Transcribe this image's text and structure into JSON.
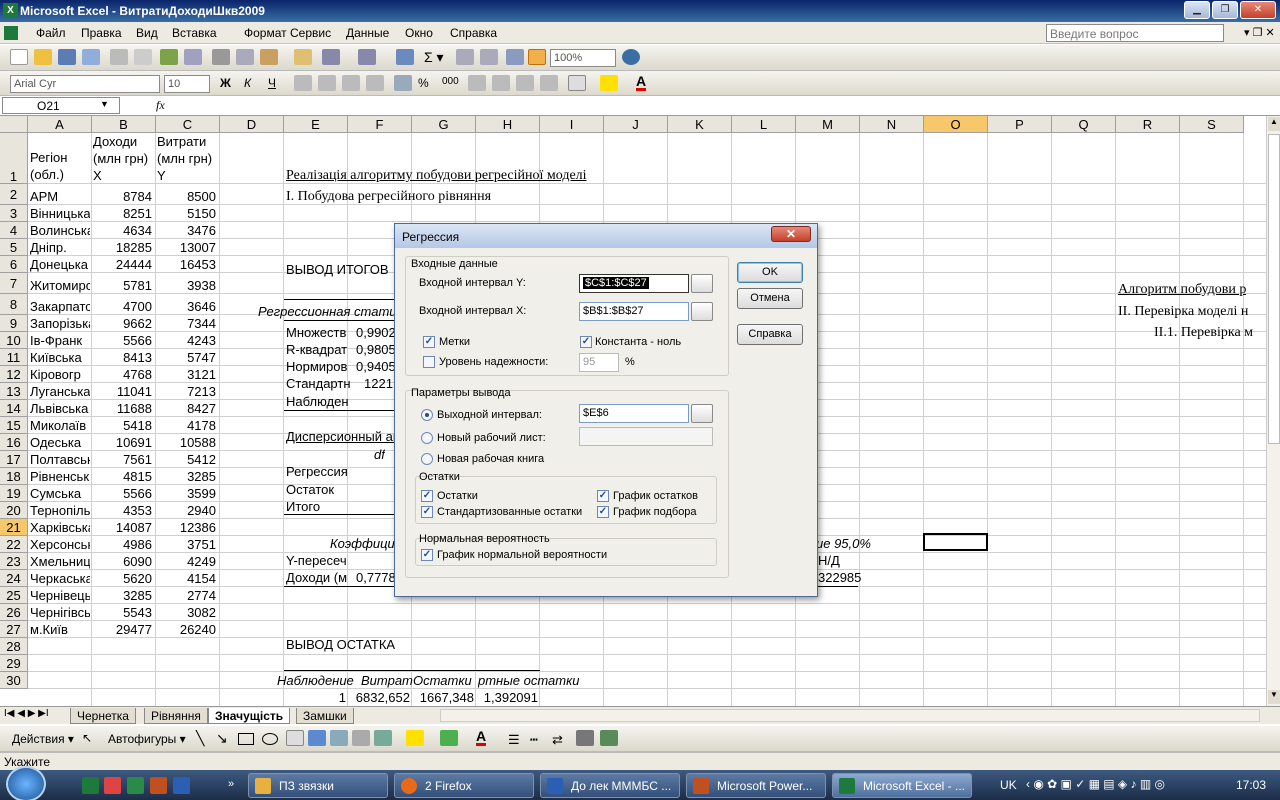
{
  "window": {
    "title": "Microsoft Excel - ВитратиДоходиШкв2009",
    "ask_placeholder": "Введите вопрос"
  },
  "menu": [
    "Файл",
    "Правка",
    "Вид",
    "Вставка",
    "Формат",
    "Сервис",
    "Данные",
    "Окно",
    "Справка"
  ],
  "toolbar": {
    "zoom": "100%",
    "font": "Arial Cyr",
    "size": "10"
  },
  "formula": {
    "namebox": "O21",
    "fx": "fx"
  },
  "columns": [
    "A",
    "B",
    "C",
    "D",
    "E",
    "F",
    "G",
    "H",
    "I",
    "J",
    "K",
    "L",
    "M",
    "N",
    "O",
    "P",
    "Q",
    "R",
    "S"
  ],
  "rows": [
    "1",
    "2",
    "3",
    "4",
    "5",
    "6",
    "7",
    "8",
    "9",
    "10",
    "11",
    "12",
    "13",
    "14",
    "15",
    "16",
    "17",
    "18",
    "19",
    "20",
    "21",
    "22",
    "23",
    "24",
    "25",
    "26",
    "27",
    "28",
    "29",
    "30"
  ],
  "header": {
    "a": [
      "Регіон",
      "(обл.)"
    ],
    "b": [
      "Доходи",
      "(млн грн)",
      "X"
    ],
    "c": [
      "Витрати",
      "(млн грн)",
      "Y"
    ]
  },
  "data": [
    [
      "АРМ",
      "8784",
      "8500"
    ],
    [
      "Вінницька",
      "8251",
      "5150"
    ],
    [
      "Волинська",
      "4634",
      "3476"
    ],
    [
      "Дніпр.",
      "18285",
      "13007"
    ],
    [
      "Донецька",
      "24444",
      "16453"
    ],
    [
      "Житомирс",
      "5781",
      "3938"
    ],
    [
      "Закарпатс",
      "4700",
      "3646"
    ],
    [
      "Запорізька",
      "9662",
      "7344"
    ],
    [
      "Ів-Франк",
      "5566",
      "4243"
    ],
    [
      "Київська",
      "8413",
      "5747"
    ],
    [
      "Кіровогр",
      "4768",
      "3121"
    ],
    [
      "Луганська",
      "11041",
      "7213"
    ],
    [
      "Львівська",
      "11688",
      "8427"
    ],
    [
      "Миколаїв",
      "5418",
      "4178"
    ],
    [
      "Одеська",
      "10691",
      "10588"
    ],
    [
      "Полтавськ",
      "7561",
      "5412"
    ],
    [
      "Рівненськ",
      "4815",
      "3285"
    ],
    [
      "Сумська",
      "5566",
      "3599"
    ],
    [
      "Тернопіль",
      "4353",
      "2940"
    ],
    [
      "Харківська",
      "14087",
      "12386"
    ],
    [
      "Херсонськ",
      "4986",
      "3751"
    ],
    [
      "Хмельниц",
      "6090",
      "4249"
    ],
    [
      "Черкаська",
      "5620",
      "4154"
    ],
    [
      "Чернівець",
      "3285",
      "2774"
    ],
    [
      "Чернігівсь",
      "5543",
      "3082"
    ],
    [
      "м.Київ",
      "29477",
      "26240"
    ]
  ],
  "sheet_text": {
    "heading1": "Реалізація алгоритму побудови регресійної моделі",
    "heading2": "І. Побудова регресійного рівняння",
    "vyvod": "ВЫВОД ИТОГОВ",
    "regstat": "Регрессионная стати",
    "mnozh": "Множеств",
    "mnozh_v": "0,9902",
    "rkv": "R-квадрат",
    "rkv_v": "0,9805",
    "norm": "Нормиров",
    "norm_v": "0,9405",
    "stand": "Стандартн",
    "stand_v": "1221,",
    "nabl": "Наблюден",
    "disp": "Дисперсионный ан",
    "df": "df",
    "regr": "Регрессия",
    "ost": "Остаток",
    "itogo": "Итого",
    "koef": "Коэффици",
    "ypers": "Y-пересеч",
    "dohody": "Доходи (м",
    "dohody_v": "0,7778",
    "upper": "ие 95,0%",
    "nd": "Н/Д",
    "m23": "322985",
    "vyvod_ost": "ВЫВОД ОСТАТКА",
    "nabl2": "Наблюдение",
    "vytrat": "Витрат",
    "ostatki": "Остатки",
    "zrt": "ртные остатки",
    "r30e": "1",
    "r30f": "6832,652",
    "r30g": "1667,348",
    "r30h": "1,392091",
    "alg": "Алгоритм побудови р",
    "prov": "ІІ. Перевірка моделі н",
    "prov1": "ІІ.1. Перевірка м"
  },
  "sheets": [
    "Чернетка",
    "Рівняння",
    "Значущість",
    "Замшки"
  ],
  "draw": {
    "actions": "Действия",
    "autoshapes": "Автофигуры"
  },
  "status": "Укажите",
  "taskbar": {
    "items": [
      "ПЗ звязки",
      "2 Firefox",
      "До лек МММБС ...",
      "Microsoft Power...",
      "Microsoft Excel - ..."
    ],
    "lang": "UK",
    "clock": "17:03"
  },
  "dialog": {
    "title": "Регрессия",
    "input_group": "Входные данные",
    "y_label": "Входной интервал Y:",
    "y_value": "$C$1:$C$27",
    "x_label": "Входной интервал X:",
    "x_value": "$B$1:$B$27",
    "labels": "Метки",
    "const_zero": "Константа - ноль",
    "conf_label": "Уровень надежности:",
    "conf_value": "95",
    "pct": "%",
    "output_group": "Параметры вывода",
    "out_range": "Выходной интервал:",
    "out_value": "$E$6",
    "new_sheet": "Новый рабочий лист:",
    "new_book": "Новая рабочая книга",
    "resid_group": "Остатки",
    "resid": "Остатки",
    "std_resid": "Стандартизованные остатки",
    "resid_plot": "График остатков",
    "fit_plot": "График подбора",
    "norm_group": "Нормальная вероятность",
    "norm_plot": "График нормальной вероятности",
    "ok": "OK",
    "cancel": "Отмена",
    "help": "Справка"
  }
}
